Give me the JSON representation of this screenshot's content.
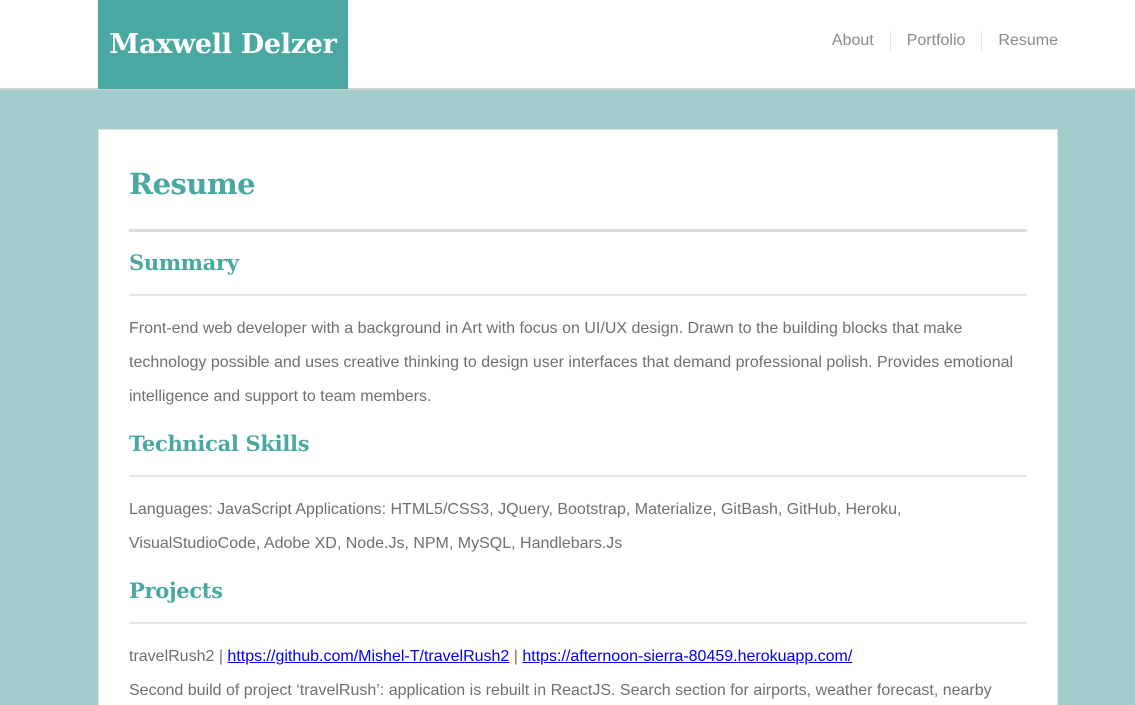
{
  "header": {
    "logo_text": "Maxwell Delzer",
    "nav": [
      "About",
      "Portfolio",
      "Resume"
    ]
  },
  "main": {
    "title": "Resume",
    "summary": {
      "heading": "Summary",
      "text": "Front-end web developer with a background in Art with focus on UI/UX design. Drawn to the building blocks that make technology possible and uses creative thinking to design user interfaces that demand professional polish. Provides emotional intelligence and support to team members."
    },
    "skills": {
      "heading": "Technical Skills",
      "text": "Languages: JavaScript Applications: HTML5/CSS3, JQuery, Bootstrap, Materialize, GitBash, GitHub, Heroku, VisualStudioCode, Adobe XD, Node.Js, NPM, MySQL, Handlebars.Js"
    },
    "projects": {
      "heading": "Projects",
      "items": [
        {
          "name": "travelRush2",
          "separator": " | ",
          "repo_link": "https://github.com/Mishel-T/travelRush2",
          "live_link": "https://afternoon-sierra-80459.herokuapp.com/",
          "description": "Second build of project ‘travelRush’: application is rebuilt in ReactJS. Search section for airports, weather forecast, nearby"
        }
      ]
    }
  },
  "colors": {
    "accent": "#4aa8a3",
    "background": "#a2cdcc",
    "text": "#6f6f6f",
    "link": "#0000ee"
  }
}
